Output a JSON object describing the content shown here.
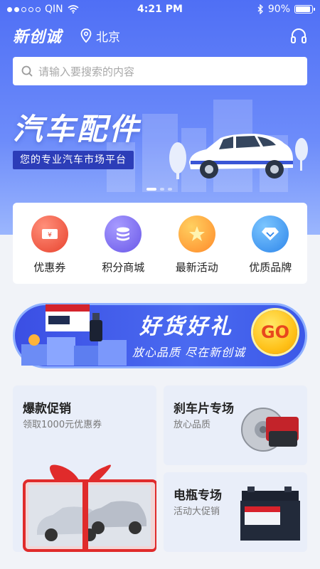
{
  "status_bar": {
    "carrier": "QIN",
    "time": "4:21 PM",
    "battery": "90%",
    "battery_level": 0.9
  },
  "header": {
    "logo": "新创诚",
    "location": "北京"
  },
  "search": {
    "placeholder": "请输入要搜索的内容"
  },
  "banner": {
    "title": "汽车配件",
    "subtitle": "您的专业汽车市场平台",
    "slide_count": 3,
    "active_slide": 1
  },
  "quick_menu": [
    {
      "label": "优惠券",
      "icon": "coupon-icon",
      "color": "#f0553f"
    },
    {
      "label": "积分商城",
      "icon": "coins-icon",
      "color": "#7b6cf0"
    },
    {
      "label": "最新活动",
      "icon": "star-icon",
      "color": "#ff9d2e"
    },
    {
      "label": "优质品牌",
      "icon": "diamond-icon",
      "color": "#3fa0f5"
    }
  ],
  "promo": {
    "title": "好货好礼",
    "subtitle": "放心品质 尽在新创诚",
    "go_label": "GO"
  },
  "cards": {
    "hot_sale": {
      "title": "爆款促销",
      "subtitle": "领取1000元优惠券"
    },
    "brake": {
      "title": "刹车片专场",
      "subtitle": "放心品质"
    },
    "battery": {
      "title": "电瓶专场",
      "subtitle": "活动大促销"
    }
  },
  "colors": {
    "primary": "#4f6ff5",
    "banner_dark": "#2c3db8",
    "page_bg": "#f1f3f8"
  }
}
